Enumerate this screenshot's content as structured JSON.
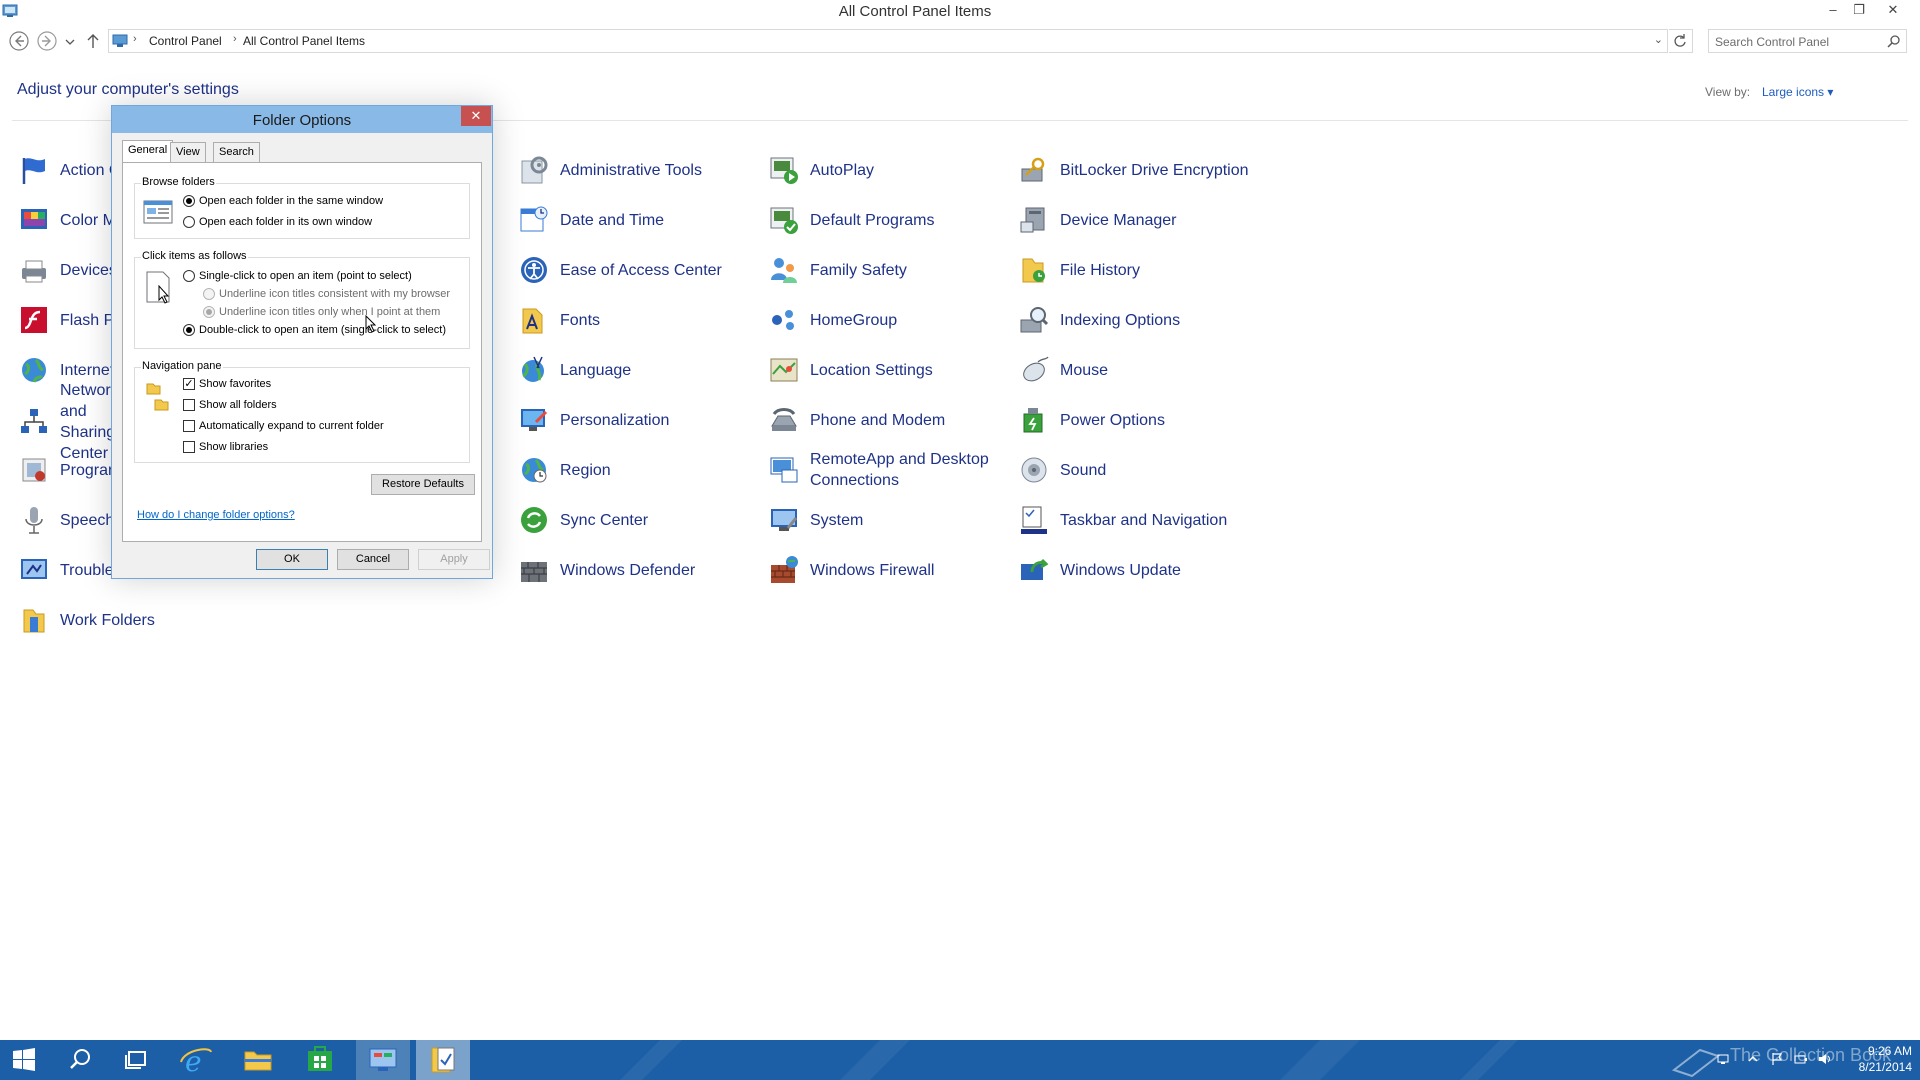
{
  "window": {
    "title": "All Control Panel Items",
    "minimize": "–",
    "restore": "❐",
    "close": "✕"
  },
  "address": {
    "crumbs": [
      "Control Panel",
      "All Control Panel Items"
    ],
    "search_placeholder": "Search Control Panel"
  },
  "main": {
    "heading": "Adjust your computer's settings",
    "view_by_label": "View by:",
    "view_by_value": "Large icons ▾"
  },
  "items": [
    {
      "label": "Action Center",
      "icon": "action-center-icon"
    },
    {
      "label": "Color Management",
      "icon": "color-management-icon"
    },
    {
      "label": "Devices and Printers",
      "icon": "devices-printers-icon"
    },
    {
      "label": "Flash Player",
      "icon": "flash-player-icon"
    },
    {
      "label": "Internet Options",
      "icon": "internet-options-icon"
    },
    {
      "label": "Network and Sharing Center",
      "icon": "network-sharing-icon"
    },
    {
      "label": "Programs and Features",
      "icon": "programs-features-icon"
    },
    {
      "label": "Speech Recognition",
      "icon": "speech-recognition-icon"
    },
    {
      "label": "Troubleshooting",
      "icon": "troubleshooting-icon"
    },
    {
      "label": "Work Folders",
      "icon": "work-folders-icon"
    },
    {
      "label": "Administrative Tools",
      "icon": "administrative-tools-icon"
    },
    {
      "label": "Date and Time",
      "icon": "date-time-icon"
    },
    {
      "label": "Ease of Access Center",
      "icon": "ease-of-access-icon"
    },
    {
      "label": "Fonts",
      "icon": "fonts-icon"
    },
    {
      "label": "Language",
      "icon": "language-icon"
    },
    {
      "label": "Personalization",
      "icon": "personalization-icon"
    },
    {
      "label": "Region",
      "icon": "region-icon"
    },
    {
      "label": "Sync Center",
      "icon": "sync-center-icon"
    },
    {
      "label": "Windows Defender",
      "icon": "windows-defender-icon"
    },
    {
      "label": "AutoPlay",
      "icon": "autoplay-icon"
    },
    {
      "label": "Default Programs",
      "icon": "default-programs-icon"
    },
    {
      "label": "Family Safety",
      "icon": "family-safety-icon"
    },
    {
      "label": "HomeGroup",
      "icon": "homegroup-icon"
    },
    {
      "label": "Location Settings",
      "icon": "location-settings-icon"
    },
    {
      "label": "Phone and Modem",
      "icon": "phone-modem-icon"
    },
    {
      "label": "RemoteApp and Desktop Connections",
      "icon": "remoteapp-icon"
    },
    {
      "label": "System",
      "icon": "system-icon"
    },
    {
      "label": "Windows Firewall",
      "icon": "windows-firewall-icon"
    },
    {
      "label": "BitLocker Drive Encryption",
      "icon": "bitlocker-icon"
    },
    {
      "label": "Device Manager",
      "icon": "device-manager-icon"
    },
    {
      "label": "File History",
      "icon": "file-history-icon"
    },
    {
      "label": "Indexing Options",
      "icon": "indexing-options-icon"
    },
    {
      "label": "Mouse",
      "icon": "mouse-icon"
    },
    {
      "label": "Power Options",
      "icon": "power-options-icon"
    },
    {
      "label": "Sound",
      "icon": "sound-icon"
    },
    {
      "label": "Taskbar and Navigation",
      "icon": "taskbar-navigation-icon"
    },
    {
      "label": "Windows Update",
      "icon": "windows-update-icon"
    }
  ],
  "dialog": {
    "title": "Folder Options",
    "tabs": [
      "General",
      "View",
      "Search"
    ],
    "active_tab": "General",
    "browse_folders": {
      "label": "Browse folders",
      "options": [
        "Open each folder in the same window",
        "Open each folder in its own window"
      ],
      "selected": 0
    },
    "click_items": {
      "label": "Click items as follows",
      "single": "Single-click to open an item (point to select)",
      "underline_browser": "Underline icon titles consistent with my browser",
      "underline_point": "Underline icon titles only when I point at them",
      "double": "Double-click to open an item (single-click to select)",
      "selected": "double"
    },
    "navigation_pane": {
      "label": "Navigation pane",
      "options": [
        {
          "label": "Show favorites",
          "checked": true
        },
        {
          "label": "Show all folders",
          "checked": false
        },
        {
          "label": "Automatically expand to current folder",
          "checked": false
        },
        {
          "label": "Show libraries",
          "checked": false
        }
      ]
    },
    "restore_defaults": "Restore Defaults",
    "help_link": "How do I change folder options?",
    "ok": "OK",
    "cancel": "Cancel",
    "apply": "Apply"
  },
  "taskbar": {
    "time": "9:26 AM",
    "date": "8/21/2014",
    "watermark": "The Collection Book"
  },
  "colors": {
    "link_blue": "#1e3287",
    "dialog_title": "#89b9e6",
    "taskbar": "#1c5fa6",
    "close_red": "#c75050"
  }
}
